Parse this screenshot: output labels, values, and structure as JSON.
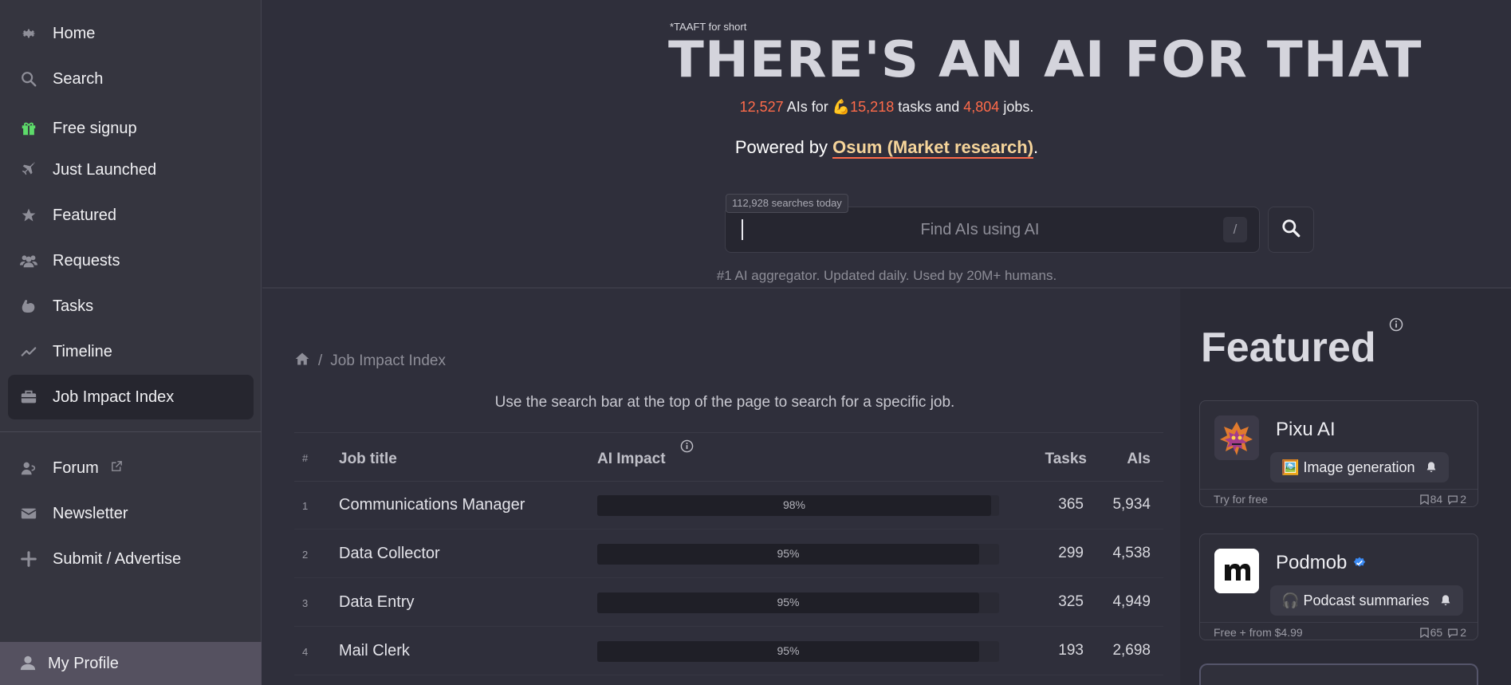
{
  "sidebar": {
    "items": [
      {
        "label": "Home",
        "icon": "gear-icon"
      },
      {
        "label": "Search",
        "icon": "search-icon"
      },
      {
        "label": "Free signup",
        "icon": "gift-icon"
      },
      {
        "label": "Just Launched",
        "icon": "plane-icon"
      },
      {
        "label": "Featured",
        "icon": "star-icon"
      },
      {
        "label": "Requests",
        "icon": "users-icon"
      },
      {
        "label": "Tasks",
        "icon": "muscle-icon"
      },
      {
        "label": "Timeline",
        "icon": "trend-icon"
      },
      {
        "label": "Job Impact Index",
        "icon": "briefcase-icon",
        "active": true
      },
      {
        "label": "Forum",
        "icon": "forum-icon",
        "external": true
      },
      {
        "label": "Newsletter",
        "icon": "envelope-icon"
      },
      {
        "label": "Submit / Advertise",
        "icon": "plus-icon"
      }
    ],
    "profile_label": "My Profile"
  },
  "header": {
    "note": "*TAAFT for short",
    "title": "THERE'S AN AI FOR THAT",
    "title_star": "*",
    "stats": {
      "ais_count": "12,527",
      "ais_text": " AIs for ",
      "task_emoji": "💪",
      "tasks_count": "15,218",
      "tasks_text": " tasks and ",
      "jobs_count": "4,804",
      "jobs_text": " jobs."
    },
    "powered_prefix": "Powered by ",
    "powered_link": "Osum (Market research)",
    "powered_suffix": ".",
    "search_count": "112,928 searches today",
    "search_placeholder": "Find AIs using AI",
    "slash_hint": "/",
    "tagline": "#1 AI aggregator. Updated daily. Used by 20M+ humans."
  },
  "main": {
    "breadcrumb_current": "Job Impact Index",
    "breadcrumb_sep": "/",
    "hint": "Use the search bar at the top of the page to search for a specific job.",
    "columns": {
      "num": "#",
      "title": "Job title",
      "impact": "AI Impact",
      "tasks": "Tasks",
      "ais": "AIs"
    },
    "rows": [
      {
        "num": "1",
        "title": "Communications Manager",
        "impact_pct": 98,
        "impact_label": "98%",
        "tasks": "365",
        "ais": "5,934"
      },
      {
        "num": "2",
        "title": "Data Collector",
        "impact_pct": 95,
        "impact_label": "95%",
        "tasks": "299",
        "ais": "4,538"
      },
      {
        "num": "3",
        "title": "Data Entry",
        "impact_pct": 95,
        "impact_label": "95%",
        "tasks": "325",
        "ais": "4,949"
      },
      {
        "num": "4",
        "title": "Mail Clerk",
        "impact_pct": 95,
        "impact_label": "95%",
        "tasks": "193",
        "ais": "2,698"
      }
    ]
  },
  "featured": {
    "title": "Featured",
    "cards": [
      {
        "name": "Pixu AI",
        "verified": false,
        "tag_emoji": "🖼️",
        "tag": "Image generation",
        "price": "Try for free",
        "saves": "84",
        "comments": "2"
      },
      {
        "name": "Podmob",
        "verified": true,
        "tag_emoji": "🎧",
        "tag": "Podcast summaries",
        "price": "Free + from $4.99",
        "saves": "65",
        "comments": "2"
      }
    ]
  },
  "colors": {
    "accent": "#ff6b4a",
    "link": "#f5d49a",
    "background": "#2f2f3b",
    "sidebar": "#35353f",
    "verified": "#3b8bf5",
    "gift": "#5ddb6a"
  }
}
